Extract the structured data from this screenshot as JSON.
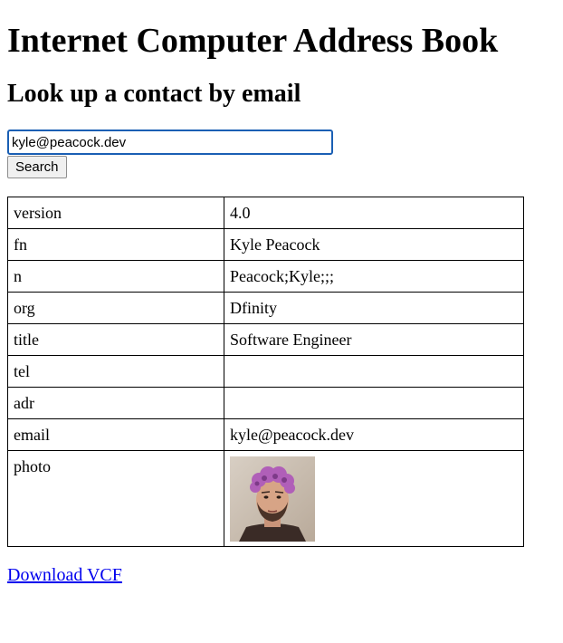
{
  "header": {
    "title": "Internet Computer Address Book",
    "subtitle": "Look up a contact by email"
  },
  "search": {
    "value": "kyle@peacock.dev",
    "button_label": "Search"
  },
  "contact": {
    "rows": [
      {
        "key": "version",
        "value": "4.0"
      },
      {
        "key": "fn",
        "value": "Kyle Peacock"
      },
      {
        "key": "n",
        "value": "Peacock;Kyle;;;"
      },
      {
        "key": "org",
        "value": "Dfinity"
      },
      {
        "key": "title",
        "value": "Software Engineer"
      },
      {
        "key": "tel",
        "value": ""
      },
      {
        "key": "adr",
        "value": ""
      },
      {
        "key": "email",
        "value": "kyle@peacock.dev"
      }
    ],
    "photo_label": "photo"
  },
  "footer": {
    "download_label": "Download VCF"
  },
  "colors": {
    "link": "#0000ee",
    "input_focus_border": "#1a5fb4",
    "hair": "#b05fb8",
    "background": "#ffffff"
  }
}
